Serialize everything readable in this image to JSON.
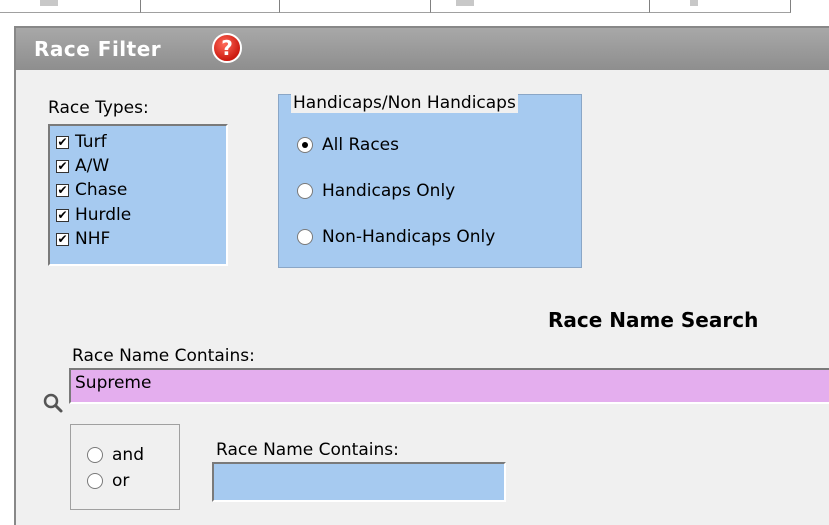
{
  "panel": {
    "title": "Race Filter",
    "help_glyph": "?",
    "help_icon": "help-icon"
  },
  "race_types": {
    "label": "Race Types:",
    "items": [
      {
        "label": "Turf",
        "checked": true
      },
      {
        "label": "A/W",
        "checked": true
      },
      {
        "label": "Chase",
        "checked": true
      },
      {
        "label": "Hurdle",
        "checked": true
      },
      {
        "label": "NHF",
        "checked": true
      }
    ]
  },
  "handicaps": {
    "legend": "Handicaps/Non Handicaps",
    "options": [
      {
        "label": "All Races",
        "selected": true
      },
      {
        "label": "Handicaps Only",
        "selected": false
      },
      {
        "label": "Non-Handicaps Only",
        "selected": false
      }
    ]
  },
  "search": {
    "heading": "Race Name Search",
    "field1_label": "Race Name Contains:",
    "field1_value": "Supreme",
    "search_icon": "magnifier-icon",
    "logic_options": [
      {
        "label": "and",
        "selected": false
      },
      {
        "label": "or",
        "selected": false
      }
    ],
    "field2_label": "Race Name Contains:",
    "field2_value": ""
  },
  "colors": {
    "list_bg": "#a6caf0",
    "search_bg": "#e4aeee",
    "title_bar": "#989898",
    "help_red": "#cc1a10"
  }
}
